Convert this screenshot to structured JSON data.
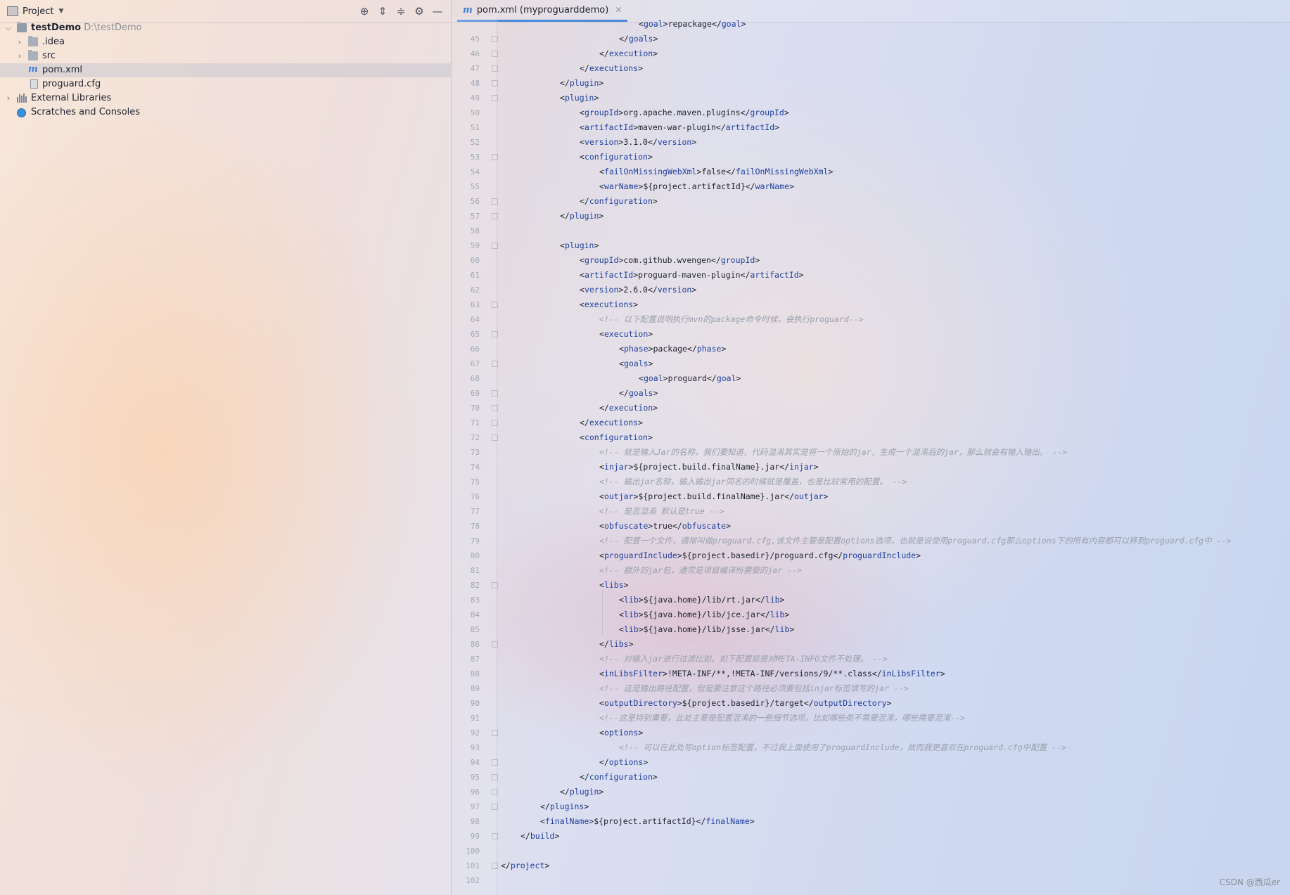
{
  "project_pane": {
    "title": "Project",
    "tree": [
      {
        "label": "testDemo",
        "path": "D:\\testDemo",
        "kind": "project",
        "depth": 0,
        "expanded": true
      },
      {
        "label": ".idea",
        "kind": "folder",
        "depth": 1,
        "expanded": false
      },
      {
        "label": "src",
        "kind": "folder",
        "depth": 1,
        "expanded": false
      },
      {
        "label": "pom.xml",
        "kind": "maven",
        "depth": 1,
        "selected": true
      },
      {
        "label": "proguard.cfg",
        "kind": "cfg",
        "depth": 1
      },
      {
        "label": "External Libraries",
        "kind": "libraries",
        "depth": 0,
        "expanded": false
      },
      {
        "label": "Scratches and Consoles",
        "kind": "scratches",
        "depth": 0
      }
    ]
  },
  "editor": {
    "tab_label": "pom.xml (myproguarddemo)",
    "lines": [
      {
        "n": "",
        "indent": 7,
        "type": "tag",
        "open": true,
        "name": "goal",
        "content": "repackage"
      },
      {
        "n": "45",
        "indent": 6,
        "type": "close",
        "name": "goals"
      },
      {
        "n": "46",
        "indent": 5,
        "type": "close",
        "name": "execution"
      },
      {
        "n": "47",
        "indent": 4,
        "type": "close",
        "name": "executions"
      },
      {
        "n": "48",
        "indent": 3,
        "type": "close",
        "name": "plugin"
      },
      {
        "n": "49",
        "indent": 3,
        "type": "open",
        "name": "plugin"
      },
      {
        "n": "50",
        "indent": 4,
        "type": "tag",
        "name": "groupId",
        "content": "org.apache.maven.plugins"
      },
      {
        "n": "51",
        "indent": 4,
        "type": "tag",
        "name": "artifactId",
        "content": "maven-war-plugin"
      },
      {
        "n": "52",
        "indent": 4,
        "type": "tag",
        "name": "version",
        "content": "3.1.0"
      },
      {
        "n": "53",
        "indent": 4,
        "type": "open",
        "name": "configuration"
      },
      {
        "n": "54",
        "indent": 5,
        "type": "tag",
        "name": "failOnMissingWebXml",
        "content": "false"
      },
      {
        "n": "55",
        "indent": 5,
        "type": "tag",
        "name": "warName",
        "content": "${project.artifactId}"
      },
      {
        "n": "56",
        "indent": 4,
        "type": "close",
        "name": "configuration"
      },
      {
        "n": "57",
        "indent": 3,
        "type": "close",
        "name": "plugin"
      },
      {
        "n": "58",
        "indent": 0,
        "type": "blank"
      },
      {
        "n": "59",
        "indent": 3,
        "type": "open",
        "name": "plugin"
      },
      {
        "n": "60",
        "indent": 4,
        "type": "tag",
        "name": "groupId",
        "content": "com.github.wvengen"
      },
      {
        "n": "61",
        "indent": 4,
        "type": "tag",
        "name": "artifactId",
        "content": "proguard-maven-plugin"
      },
      {
        "n": "62",
        "indent": 4,
        "type": "tag",
        "name": "version",
        "content": "2.6.0"
      },
      {
        "n": "63",
        "indent": 4,
        "type": "open",
        "name": "executions"
      },
      {
        "n": "64",
        "indent": 5,
        "type": "comment",
        "content": "<!-- 以下配置说明执行mvn的package命令时候，会执行proguard-->"
      },
      {
        "n": "65",
        "indent": 5,
        "type": "open",
        "name": "execution"
      },
      {
        "n": "66",
        "indent": 6,
        "type": "tag",
        "name": "phase",
        "content": "package"
      },
      {
        "n": "67",
        "indent": 6,
        "type": "open",
        "name": "goals"
      },
      {
        "n": "68",
        "indent": 7,
        "type": "tag",
        "name": "goal",
        "content": "proguard"
      },
      {
        "n": "69",
        "indent": 6,
        "type": "close",
        "name": "goals"
      },
      {
        "n": "70",
        "indent": 5,
        "type": "close",
        "name": "execution"
      },
      {
        "n": "71",
        "indent": 4,
        "type": "close",
        "name": "executions"
      },
      {
        "n": "72",
        "indent": 4,
        "type": "open",
        "name": "configuration"
      },
      {
        "n": "73",
        "indent": 5,
        "type": "comment",
        "content": "<!-- 就是输入Jar的名称，我们要知道，代码混淆其实是将一个原始的jar，生成一个混淆后的jar，那么就会有输入输出。 -->"
      },
      {
        "n": "74",
        "indent": 5,
        "type": "tag",
        "name": "injar",
        "content": "${project.build.finalName}.jar"
      },
      {
        "n": "75",
        "indent": 5,
        "type": "comment",
        "content": "<!-- 输出jar名称，输入输出jar同名的时候就是覆盖，也是比较常用的配置。 -->"
      },
      {
        "n": "76",
        "indent": 5,
        "type": "tag",
        "name": "outjar",
        "content": "${project.build.finalName}.jar"
      },
      {
        "n": "77",
        "indent": 5,
        "type": "comment",
        "content": "<!-- 是否混淆 默认是true -->"
      },
      {
        "n": "78",
        "indent": 5,
        "type": "tag",
        "name": "obfuscate",
        "content": "true"
      },
      {
        "n": "79",
        "indent": 5,
        "type": "comment",
        "content": "<!-- 配置一个文件，通常叫做proguard.cfg,该文件主要是配置options选项，也就是说使用proguard.cfg那么options下的所有内容都可以移到proguard.cfg中 -->"
      },
      {
        "n": "80",
        "indent": 5,
        "type": "tag",
        "name": "proguardInclude",
        "content": "${project.basedir}/proguard.cfg"
      },
      {
        "n": "81",
        "indent": 5,
        "type": "comment",
        "content": "<!-- 额外的jar包，通常是项目编译所需要的jar -->"
      },
      {
        "n": "82",
        "indent": 5,
        "type": "open",
        "name": "libs"
      },
      {
        "n": "83",
        "indent": 6,
        "type": "tag",
        "name": "lib",
        "content": "${java.home}/lib/rt.jar"
      },
      {
        "n": "84",
        "indent": 6,
        "type": "tag",
        "name": "lib",
        "content": "${java.home}/lib/jce.jar"
      },
      {
        "n": "85",
        "indent": 6,
        "type": "tag",
        "name": "lib",
        "content": "${java.home}/lib/jsse.jar"
      },
      {
        "n": "86",
        "indent": 5,
        "type": "close",
        "name": "libs"
      },
      {
        "n": "87",
        "indent": 5,
        "type": "comment",
        "content": "<!-- 对输入jar进行过滤比如，如下配置就是对META-INFO文件不处理。 -->"
      },
      {
        "n": "88",
        "indent": 5,
        "type": "tag",
        "name": "inLibsFilter",
        "content": "!META-INF/**,!META-INF/versions/9/**.class"
      },
      {
        "n": "89",
        "indent": 5,
        "type": "comment",
        "content": "<!-- 这是输出路径配置，但是要注意这个路径必须要包括injar标签填写的jar -->"
      },
      {
        "n": "90",
        "indent": 5,
        "type": "tag",
        "name": "outputDirectory",
        "content": "${project.basedir}/target"
      },
      {
        "n": "91",
        "indent": 5,
        "type": "comment",
        "content": "<!--这里特别重要，此处主要是配置混淆的一些细节选项，比如哪些类不需要混淆，哪些需要混淆-->"
      },
      {
        "n": "92",
        "indent": 5,
        "type": "open",
        "name": "options"
      },
      {
        "n": "93",
        "indent": 6,
        "type": "comment",
        "content": "<!-- 可以在此处写option标签配置，不过我上面使用了proguardInclude，故而我更喜欢在proguard.cfg中配置 -->"
      },
      {
        "n": "94",
        "indent": 5,
        "type": "close",
        "name": "options"
      },
      {
        "n": "95",
        "indent": 4,
        "type": "close",
        "name": "configuration"
      },
      {
        "n": "96",
        "indent": 3,
        "type": "close",
        "name": "plugin"
      },
      {
        "n": "97",
        "indent": 2,
        "type": "close",
        "name": "plugins"
      },
      {
        "n": "98",
        "indent": 2,
        "type": "tag",
        "name": "finalName",
        "content": "${project.artifactId}"
      },
      {
        "n": "99",
        "indent": 1,
        "type": "close",
        "name": "build"
      },
      {
        "n": "100",
        "indent": 0,
        "type": "blank"
      },
      {
        "n": "101",
        "indent": 0,
        "type": "close",
        "name": "project"
      },
      {
        "n": "102",
        "indent": 0,
        "type": "blank"
      }
    ]
  },
  "watermark": "CSDN @西瓜er"
}
